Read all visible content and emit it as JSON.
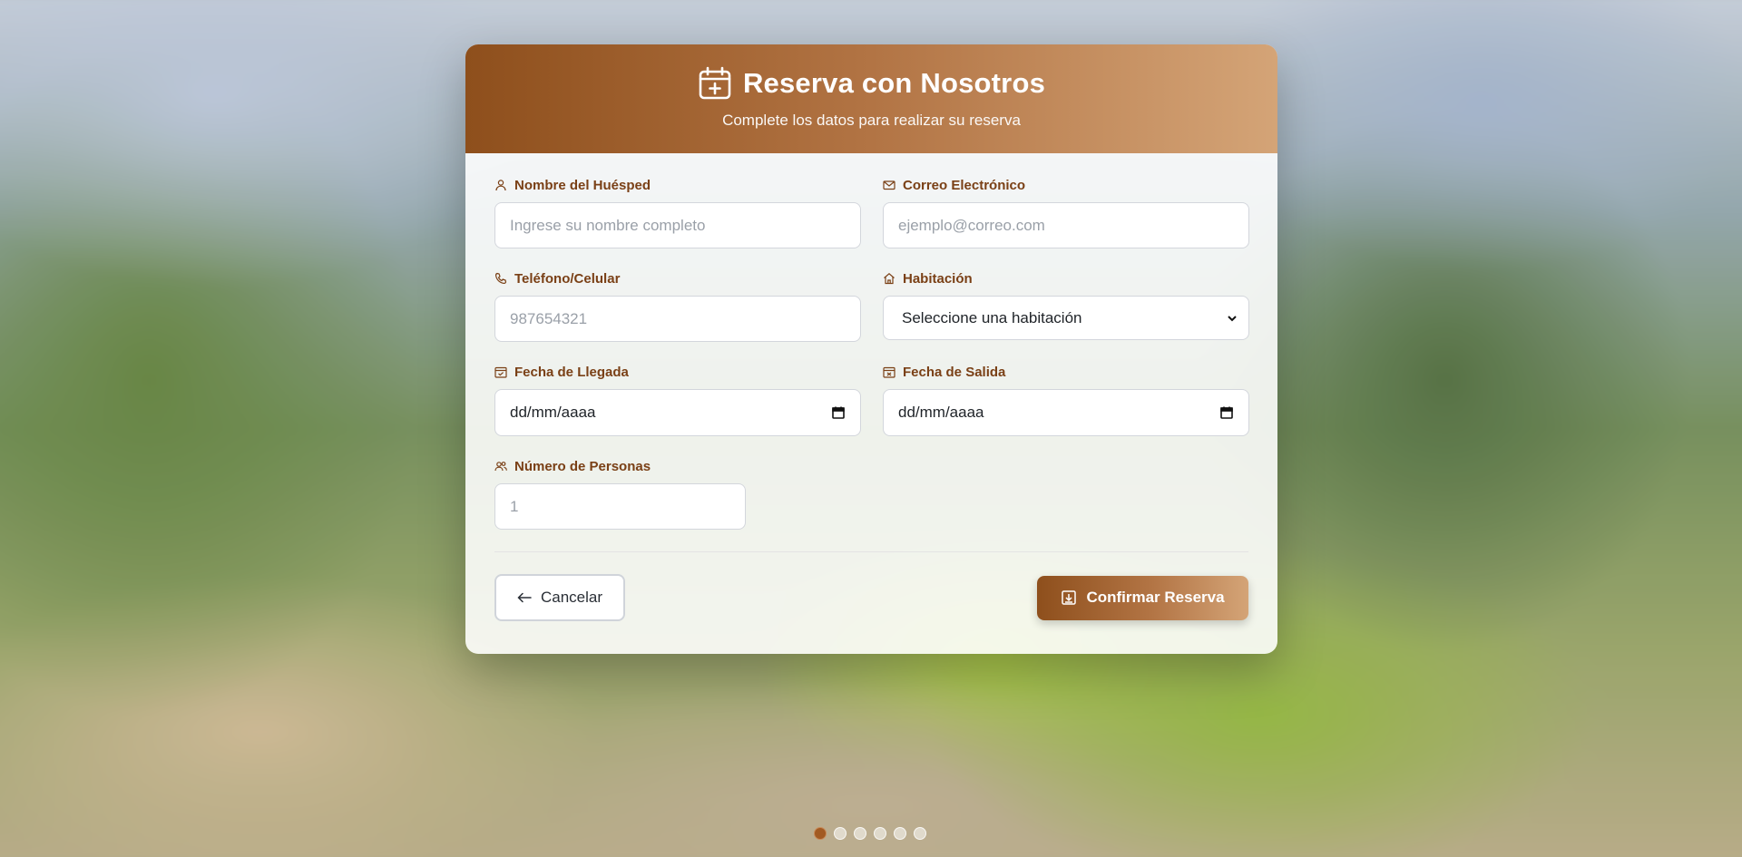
{
  "header": {
    "title": "Reserva con Nosotros",
    "subtitle": "Complete los datos para realizar su reserva",
    "icon": "calendar-plus-icon"
  },
  "form": {
    "guest_name": {
      "label": "Nombre del Huésped",
      "placeholder": "Ingrese su nombre completo",
      "icon": "user-icon"
    },
    "email": {
      "label": "Correo Electrónico",
      "placeholder": "ejemplo@correo.com",
      "icon": "mail-icon"
    },
    "phone": {
      "label": "Teléfono/Celular",
      "placeholder": "987654321",
      "icon": "phone-icon"
    },
    "room": {
      "label": "Habitación",
      "selected": "Seleccione una habitación",
      "icon": "home-icon"
    },
    "arrival": {
      "label": "Fecha de Llegada",
      "value": "dd/mm/aaaa",
      "icon": "calendar-check-icon"
    },
    "departure": {
      "label": "Fecha de Salida",
      "value": "dd/mm/aaaa",
      "icon": "calendar-x-icon"
    },
    "guests": {
      "label": "Número de Personas",
      "placeholder": "1",
      "icon": "users-icon"
    }
  },
  "actions": {
    "cancel_label": "Cancelar",
    "confirm_label": "Confirmar Reserva"
  },
  "carousel": {
    "slide_count": 6,
    "active_index": 0
  },
  "colors": {
    "accent": "#8e4f1c",
    "accent_light": "#d4a477",
    "label": "#7a4016"
  }
}
